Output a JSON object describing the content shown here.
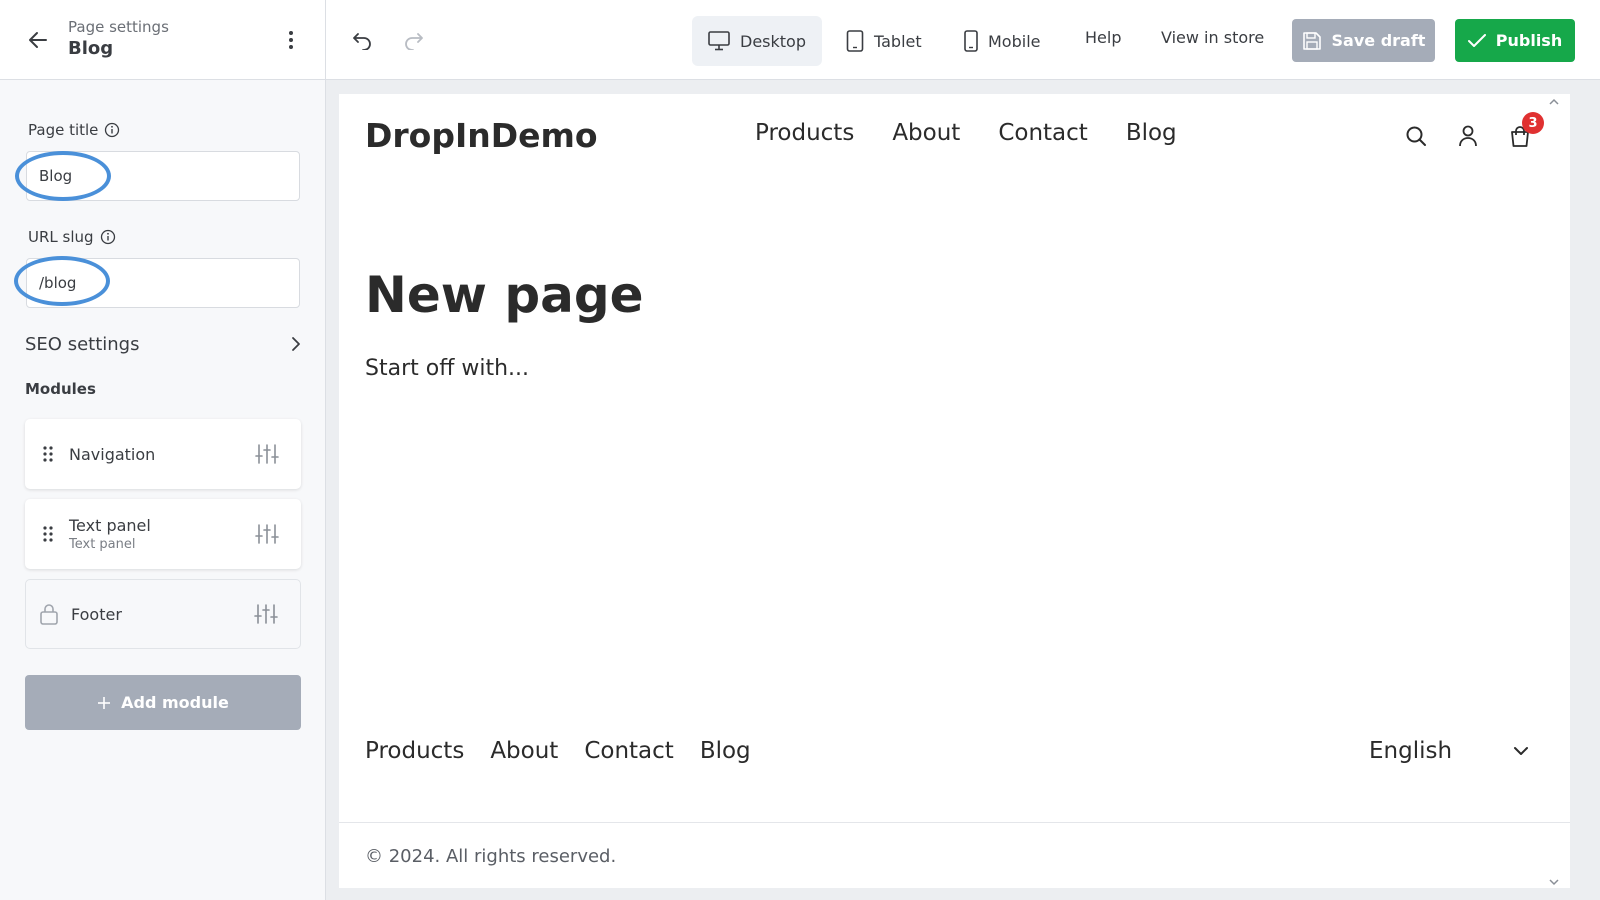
{
  "sidebar": {
    "subtitle": "Page settings",
    "title": "Blog",
    "page_title_label": "Page title",
    "page_title_value": "Blog",
    "url_slug_label": "URL slug",
    "url_slug_value": "/blog",
    "seo_label": "SEO settings",
    "modules_heading": "Modules",
    "modules": [
      {
        "name": "Navigation",
        "sub": ""
      },
      {
        "name": "Text panel",
        "sub": "Text panel"
      },
      {
        "name": "Footer",
        "sub": ""
      }
    ],
    "add_module_label": "Add module"
  },
  "toolbar": {
    "devices": [
      "Desktop",
      "Tablet",
      "Mobile"
    ],
    "active_device": "Desktop",
    "help_label": "Help",
    "view_store_label": "View in store",
    "save_draft_label": "Save draft",
    "publish_label": "Publish"
  },
  "store": {
    "logo": "DropInDemo",
    "nav": [
      "Products",
      "About",
      "Contact",
      "Blog"
    ],
    "cart_count": "3",
    "heading": "New page",
    "intro": "Start off with...",
    "footer_nav": [
      "Products",
      "About",
      "Contact",
      "Blog"
    ],
    "language": "English",
    "copyright": "© 2024. All rights reserved."
  },
  "colors": {
    "accent_ring": "#4a90d9",
    "publish": "#16a84a",
    "disabled": "#a5acb8",
    "badge": "#e03131"
  },
  "icons": {
    "back": "arrow-left-icon",
    "more": "kebab-icon",
    "undo": "undo-icon",
    "redo": "redo-icon",
    "desktop": "monitor-icon",
    "tablet": "tablet-icon",
    "mobile": "phone-icon",
    "save": "floppy-icon",
    "publish": "check-icon",
    "search": "search-icon",
    "account": "user-icon",
    "cart": "bag-icon"
  }
}
